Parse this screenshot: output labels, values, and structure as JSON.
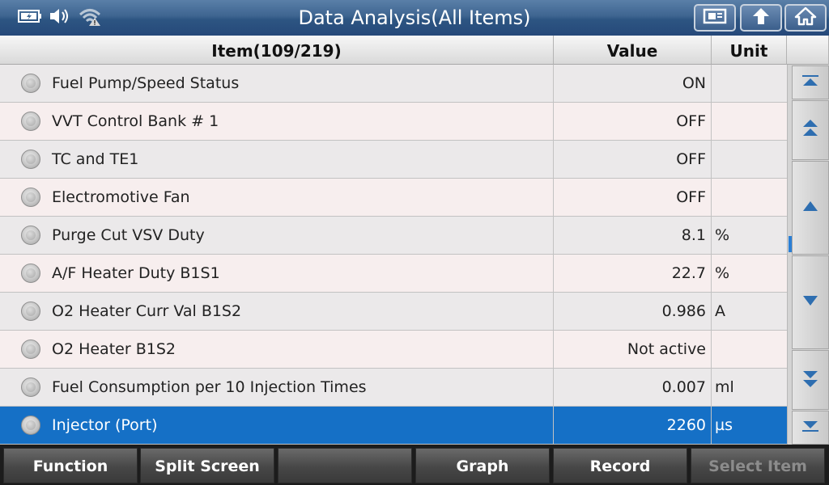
{
  "header": {
    "title": "Data Analysis(All Items)",
    "icons": [
      "battery-icon",
      "speaker-icon",
      "wifi-warning-icon"
    ],
    "buttons": [
      "screenshot-icon",
      "back-icon",
      "home-icon"
    ]
  },
  "table": {
    "columns": {
      "item": "Item(109/219)",
      "value": "Value",
      "unit": "Unit"
    },
    "rows": [
      {
        "item": "Fuel Pump/Speed Status",
        "value": "ON",
        "unit": ""
      },
      {
        "item": "VVT Control Bank # 1",
        "value": "OFF",
        "unit": ""
      },
      {
        "item": "TC and TE1",
        "value": "OFF",
        "unit": ""
      },
      {
        "item": "Electromotive Fan",
        "value": "OFF",
        "unit": ""
      },
      {
        "item": "Purge Cut VSV Duty",
        "value": "8.1",
        "unit": "%"
      },
      {
        "item": "A/F Heater Duty B1S1",
        "value": "22.7",
        "unit": "%"
      },
      {
        "item": "O2 Heater Curr Val B1S2",
        "value": "0.986",
        "unit": "A"
      },
      {
        "item": "O2 Heater B1S2",
        "value": "Not active",
        "unit": ""
      },
      {
        "item": "Fuel Consumption per 10 Injection Times",
        "value": "0.007",
        "unit": "ml"
      },
      {
        "item": "Injector (Port)",
        "value": "2260",
        "unit": "µs"
      }
    ],
    "selected_index": 9
  },
  "scrollbar": {
    "buttons": [
      "scroll-top-icon",
      "page-up-icon",
      "line-up-icon",
      "line-down-icon",
      "page-down-icon",
      "scroll-bottom-icon"
    ],
    "position": 0.5
  },
  "toolbar": {
    "buttons": [
      {
        "label": "Function",
        "enabled": true
      },
      {
        "label": "Split Screen",
        "enabled": true
      },
      {
        "label": "",
        "enabled": true
      },
      {
        "label": "Graph",
        "enabled": true
      },
      {
        "label": "Record",
        "enabled": true
      },
      {
        "label": "Select Item",
        "enabled": false
      }
    ]
  },
  "colors": {
    "accent": "#1570c6",
    "header_bar": "#2d5582"
  }
}
